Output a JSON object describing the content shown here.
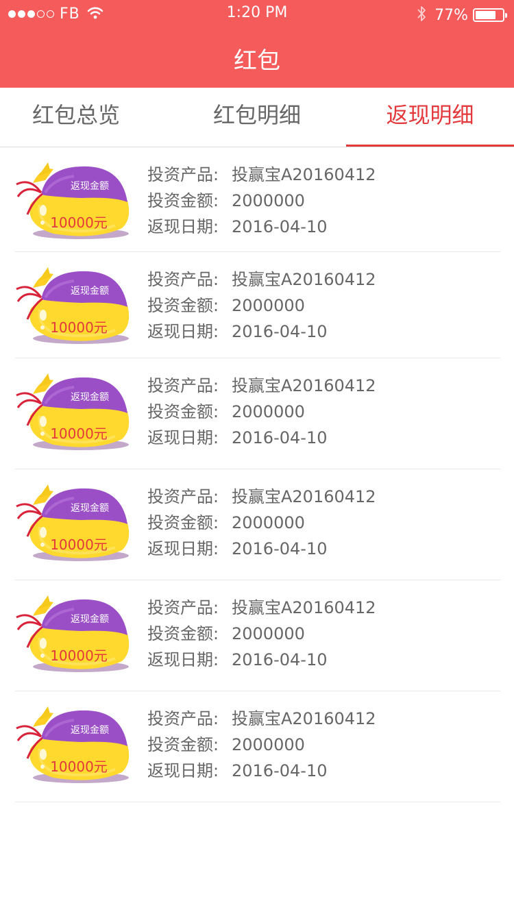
{
  "status_bar": {
    "carrier": "FB",
    "time": "1:20 PM",
    "battery": "77%",
    "battery_level": 0.77,
    "signal_bars_filled": 3,
    "signal_bars_total": 5
  },
  "header": {
    "title": "红包"
  },
  "tabs": [
    {
      "label": "红包总览",
      "active": false
    },
    {
      "label": "红包明细",
      "active": false
    },
    {
      "label": "返现明细",
      "active": true
    }
  ],
  "item_labels": {
    "product": "投资产品:",
    "amount": "投资金额:",
    "date": "返现日期:"
  },
  "items": [
    {
      "badge_label": "返现金额",
      "badge_amount": "10000元",
      "product": "投赢宝A20160412",
      "amount": "2000000",
      "date": "2016-04-10"
    },
    {
      "badge_label": "返现金额",
      "badge_amount": "10000元",
      "product": "投赢宝A20160412",
      "amount": "2000000",
      "date": "2016-04-10"
    },
    {
      "badge_label": "返现金额",
      "badge_amount": "10000元",
      "product": "投赢宝A20160412",
      "amount": "2000000",
      "date": "2016-04-10"
    },
    {
      "badge_label": "返现金额",
      "badge_amount": "10000元",
      "product": "投赢宝A20160412",
      "amount": "2000000",
      "date": "2016-04-10"
    },
    {
      "badge_label": "返现金额",
      "badge_amount": "10000元",
      "product": "投赢宝A20160412",
      "amount": "2000000",
      "date": "2016-04-10"
    },
    {
      "badge_label": "返现金额",
      "badge_amount": "10000元",
      "product": "投赢宝A20160412",
      "amount": "2000000",
      "date": "2016-04-10"
    }
  ],
  "colors": {
    "header_bg": "#f55b5b",
    "accent": "#e4393c",
    "text": "#666666",
    "bag_yellow": "#ffd92e",
    "bag_purple": "#9b4fc7"
  },
  "icons": [
    "signal-dots-icon",
    "wifi-icon",
    "bluetooth-icon",
    "battery-icon",
    "money-bag-icon"
  ]
}
